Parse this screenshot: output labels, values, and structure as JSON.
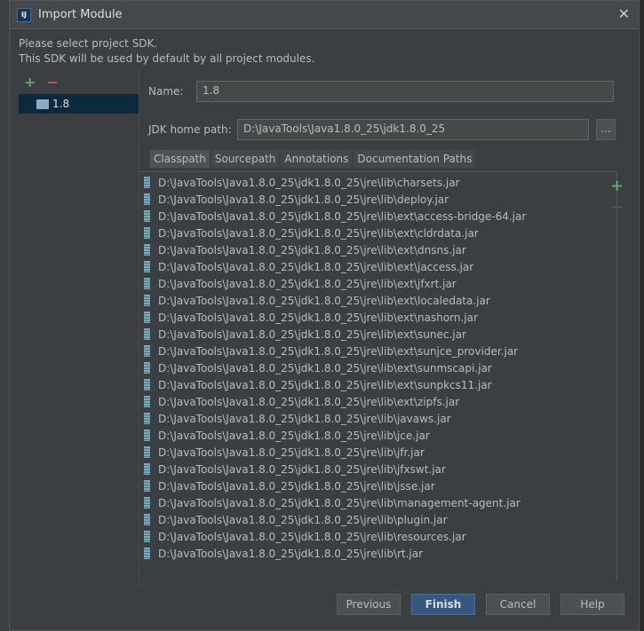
{
  "title": "Import Module",
  "intro": {
    "line1": "Please select project SDK.",
    "line2": "This SDK will be used by default by all project modules."
  },
  "sdk_list": [
    {
      "label": "1.8"
    }
  ],
  "name_label": "Name:",
  "name_value": "1.8",
  "jdk_label": "JDK home path:",
  "jdk_value": "D:\\JavaTools\\Java1.8.0_25\\jdk1.8.0_25",
  "browse_label": "...",
  "tabs": [
    "Classpath",
    "Sourcepath",
    "Annotations",
    "Documentation Paths"
  ],
  "classpath": [
    "D:\\JavaTools\\Java1.8.0_25\\jdk1.8.0_25\\jre\\lib\\charsets.jar",
    "D:\\JavaTools\\Java1.8.0_25\\jdk1.8.0_25\\jre\\lib\\deploy.jar",
    "D:\\JavaTools\\Java1.8.0_25\\jdk1.8.0_25\\jre\\lib\\ext\\access-bridge-64.jar",
    "D:\\JavaTools\\Java1.8.0_25\\jdk1.8.0_25\\jre\\lib\\ext\\cldrdata.jar",
    "D:\\JavaTools\\Java1.8.0_25\\jdk1.8.0_25\\jre\\lib\\ext\\dnsns.jar",
    "D:\\JavaTools\\Java1.8.0_25\\jdk1.8.0_25\\jre\\lib\\ext\\jaccess.jar",
    "D:\\JavaTools\\Java1.8.0_25\\jdk1.8.0_25\\jre\\lib\\ext\\jfxrt.jar",
    "D:\\JavaTools\\Java1.8.0_25\\jdk1.8.0_25\\jre\\lib\\ext\\localedata.jar",
    "D:\\JavaTools\\Java1.8.0_25\\jdk1.8.0_25\\jre\\lib\\ext\\nashorn.jar",
    "D:\\JavaTools\\Java1.8.0_25\\jdk1.8.0_25\\jre\\lib\\ext\\sunec.jar",
    "D:\\JavaTools\\Java1.8.0_25\\jdk1.8.0_25\\jre\\lib\\ext\\sunjce_provider.jar",
    "D:\\JavaTools\\Java1.8.0_25\\jdk1.8.0_25\\jre\\lib\\ext\\sunmscapi.jar",
    "D:\\JavaTools\\Java1.8.0_25\\jdk1.8.0_25\\jre\\lib\\ext\\sunpkcs11.jar",
    "D:\\JavaTools\\Java1.8.0_25\\jdk1.8.0_25\\jre\\lib\\ext\\zipfs.jar",
    "D:\\JavaTools\\Java1.8.0_25\\jdk1.8.0_25\\jre\\lib\\javaws.jar",
    "D:\\JavaTools\\Java1.8.0_25\\jdk1.8.0_25\\jre\\lib\\jce.jar",
    "D:\\JavaTools\\Java1.8.0_25\\jdk1.8.0_25\\jre\\lib\\jfr.jar",
    "D:\\JavaTools\\Java1.8.0_25\\jdk1.8.0_25\\jre\\lib\\jfxswt.jar",
    "D:\\JavaTools\\Java1.8.0_25\\jdk1.8.0_25\\jre\\lib\\jsse.jar",
    "D:\\JavaTools\\Java1.8.0_25\\jdk1.8.0_25\\jre\\lib\\management-agent.jar",
    "D:\\JavaTools\\Java1.8.0_25\\jdk1.8.0_25\\jre\\lib\\plugin.jar",
    "D:\\JavaTools\\Java1.8.0_25\\jdk1.8.0_25\\jre\\lib\\resources.jar",
    "D:\\JavaTools\\Java1.8.0_25\\jdk1.8.0_25\\jre\\lib\\rt.jar"
  ],
  "buttons": {
    "previous": "Previous",
    "finish": "Finish",
    "cancel": "Cancel",
    "help": "Help"
  },
  "colors": {
    "accent": "#365880",
    "add": "#59a869",
    "remove": "#c75450",
    "selection": "#0d293e"
  }
}
